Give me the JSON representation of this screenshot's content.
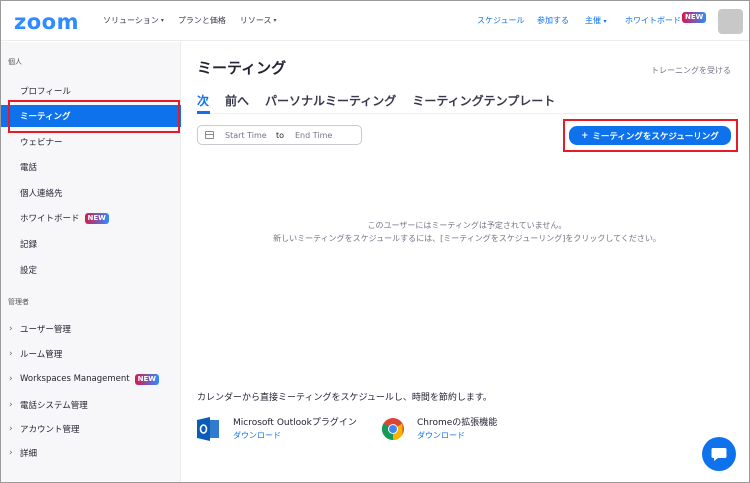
{
  "header": {
    "logo": "zoom",
    "nav_left": [
      {
        "label": "ソリューション",
        "caret": true
      },
      {
        "label": "プランと価格",
        "caret": false
      },
      {
        "label": "リソース",
        "caret": true
      }
    ],
    "nav_right": {
      "schedule": "スケジュール",
      "join": "参加する",
      "host": "主催",
      "whiteboard": "ホワイトボード",
      "new_badge": "NEW"
    }
  },
  "sidebar": {
    "personal_label": "個人",
    "items": [
      {
        "label": "プロフィール"
      },
      {
        "label": "ミーティング"
      },
      {
        "label": "ウェビナー"
      },
      {
        "label": "電話"
      },
      {
        "label": "個人連絡先"
      },
      {
        "label": "ホワイトボード",
        "badge": "NEW"
      },
      {
        "label": "記録"
      },
      {
        "label": "設定"
      }
    ],
    "admin_label": "管理者",
    "admin_items": [
      {
        "label": "ユーザー管理"
      },
      {
        "label": "ルーム管理"
      },
      {
        "label": "Workspaces Management",
        "badge": "NEW"
      },
      {
        "label": "電話システム管理"
      },
      {
        "label": "アカウント管理"
      },
      {
        "label": "詳細"
      }
    ]
  },
  "main": {
    "title": "ミーティング",
    "training_link": "トレーニングを受ける",
    "tabs": [
      {
        "label": "次"
      },
      {
        "label": "前へ"
      },
      {
        "label": "パーソナルミーティング"
      },
      {
        "label": "ミーティングテンプレート"
      }
    ],
    "date_range": {
      "start_placeholder": "Start Time",
      "to": "to",
      "end_placeholder": "End Time"
    },
    "schedule_button": "ミーティングをスケジューリング",
    "empty_line1": "このユーザーにはミーティングは予定されていません。",
    "empty_line2": "新しいミーティングをスケジュールするには、[ミーティングをスケジューリング]をクリックしてください。",
    "promo_text": "カレンダーから直接ミーティングをスケジュールし、時間を節約します。",
    "integrations": [
      {
        "name": "Microsoft Outlookプラグイン",
        "link": "ダウンロード"
      },
      {
        "name": "Chromeの拡張機能",
        "link": "ダウンロード"
      }
    ]
  },
  "colors": {
    "accent": "#0E72ED",
    "highlight_box": "#e81a26"
  }
}
